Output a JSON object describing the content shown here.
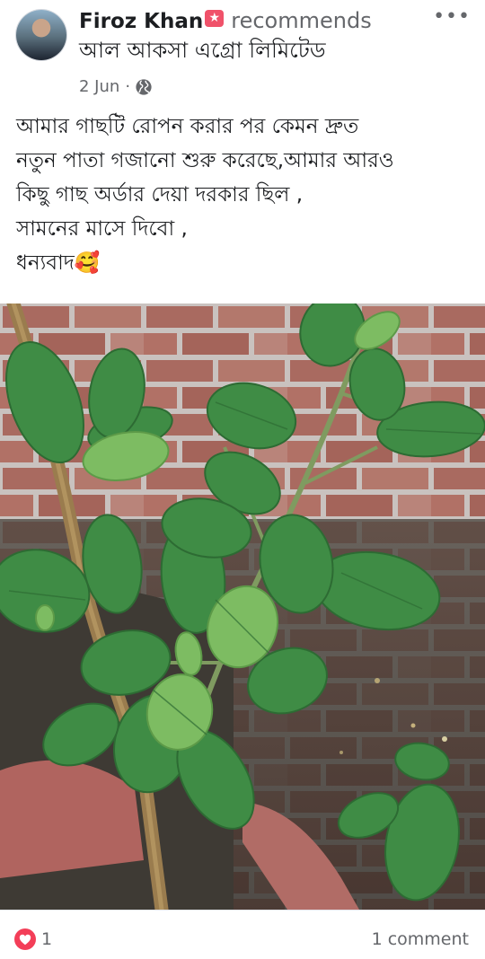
{
  "post": {
    "author": "Firoz Khan",
    "action": "recommends",
    "page": "আল আকসা এগ্রো লিমিটেড",
    "date": "2 Jun",
    "separator": "·",
    "more_label": "•••",
    "text_lines": [
      "আমার গাছটি রোপন করার পর কেমন দ্রুত",
      "নতুন পাতা গজানো শুরু করেছে,আমার আরও",
      "কিছু গাছ অর্ডার দেয়া দরকার ছিল ,",
      "সামনের মাসে দিবো ,",
      "ধন্যবাদ🥰"
    ],
    "reactions": {
      "count": "1",
      "icon": "heart-icon"
    },
    "comments": "1 comment"
  },
  "icons": {
    "recommend": "recommend-star-icon",
    "audience": "globe-icon",
    "more": "more-options-icon"
  },
  "colors": {
    "recommend_badge": "#f0526a",
    "heart_badge": "#f33e58",
    "secondary_text": "#65676b"
  }
}
